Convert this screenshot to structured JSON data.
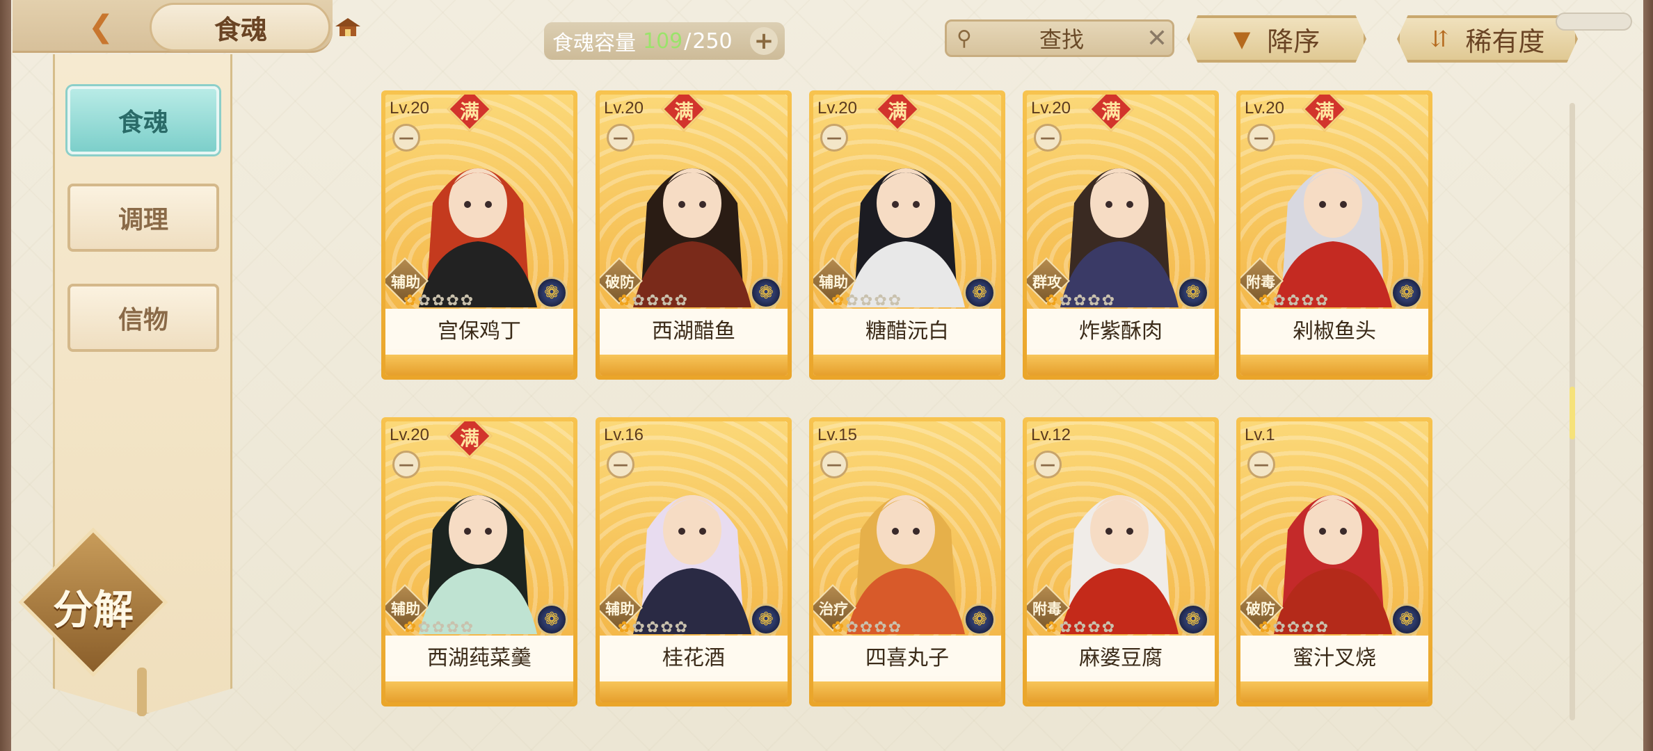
{
  "header": {
    "title": "食魂",
    "capacity": {
      "label": "食魂容量",
      "current": "109",
      "max": "250"
    },
    "search_text": "查找",
    "sort_label": "降序",
    "rarity_label": "稀有度"
  },
  "sidebar": {
    "tabs": [
      {
        "label": "食魂",
        "active": true
      },
      {
        "label": "调理",
        "active": false
      },
      {
        "label": "信物",
        "active": false
      }
    ],
    "decompose_label": "分解"
  },
  "cards": [
    {
      "level": "Lv.20",
      "max": "满",
      "role": "辅助",
      "name": "宫保鸡丁",
      "stars": 1,
      "hair": "#c43a1e",
      "cloth": "#222"
    },
    {
      "level": "Lv.20",
      "max": "满",
      "role": "破防",
      "name": "西湖醋鱼",
      "stars": 1,
      "hair": "#2a1c14",
      "cloth": "#7a2a1a"
    },
    {
      "level": "Lv.20",
      "max": "满",
      "role": "辅助",
      "name": "糖醋沅白",
      "stars": 1,
      "hair": "#1c1c22",
      "cloth": "#e8e8e8"
    },
    {
      "level": "Lv.20",
      "max": "满",
      "role": "群攻",
      "name": "炸紫酥肉",
      "stars": 1,
      "hair": "#3a2a22",
      "cloth": "#3a3a66"
    },
    {
      "level": "Lv.20",
      "max": "满",
      "role": "附毒",
      "name": "剁椒鱼头",
      "stars": 1,
      "hair": "#d8d8e0",
      "cloth": "#c42a22"
    },
    {
      "level": "Lv.20",
      "max": "满",
      "role": "辅助",
      "name": "西湖莼菜羹",
      "stars": 1,
      "hair": "#1c2420",
      "cloth": "#bfe3d2"
    },
    {
      "level": "Lv.16",
      "max": "",
      "role": "辅助",
      "name": "桂花酒",
      "stars": 1,
      "hair": "#e8dcf0",
      "cloth": "#2a2a44"
    },
    {
      "level": "Lv.15",
      "max": "",
      "role": "治疗",
      "name": "四喜丸子",
      "stars": 1,
      "hair": "#e6b04a",
      "cloth": "#d85a2a"
    },
    {
      "level": "Lv.12",
      "max": "",
      "role": "附毒",
      "name": "麻婆豆腐",
      "stars": 1,
      "hair": "#f0ece8",
      "cloth": "#c42a1a"
    },
    {
      "level": "Lv.1",
      "max": "",
      "role": "破防",
      "name": "蜜汁叉烧",
      "stars": 1,
      "hair": "#c42a2a",
      "cloth": "#b42a1a"
    }
  ]
}
